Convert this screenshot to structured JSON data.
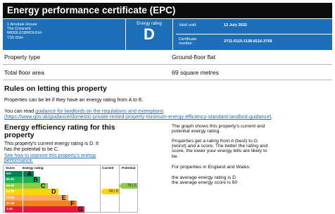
{
  "title": "Energy performance certificate (EPC)",
  "address": [
    "1 Airedale House",
    "The Crescent",
    "MIDDLESBROUGH",
    "TS5 6SH"
  ],
  "rating_label": "Energy rating",
  "rating_letter": "D",
  "valid_until_label": "Valid until:",
  "valid_until_value": "12 July 2032",
  "certificate_number_label": [
    "Certificate",
    "number:"
  ],
  "certificate_number_value": "2711-5115-1138-8116-3759",
  "summary": [
    {
      "key": "Property type",
      "value": "Ground-floor flat"
    },
    {
      "key": "Total floor area",
      "value": "69 square metres"
    }
  ],
  "rules_heading": "Rules on letting this property",
  "rules_p1": "Properties can be let if they have an energy rating from A to E.",
  "rules_p2_prefix": "You can read ",
  "rules_p2_link": "guidance for landlords on the regulations and exemptions",
  "rules_p2_url": "(https://www.gov.uk/guidance/domestic-private-rented-property-minimum-energy-efficiency-standard-landlord-guidance)",
  "rules_p2_suffix": ".",
  "efficiency_heading": [
    "Energy efficiency rating for this",
    "property"
  ],
  "efficiency_p1": [
    "This property's current energy rating is D. It",
    "has the potential to be C."
  ],
  "efficiency_link": [
    "See how to improve this property's energy",
    "performance."
  ],
  "scale_headers": {
    "score": "Score",
    "energy_rating": "Energy rating",
    "current": "Current",
    "potential": "Potential"
  },
  "bands": [
    {
      "score": "92+",
      "letter": "A",
      "color": "#008054",
      "fill": 0.14
    },
    {
      "score": "81-91",
      "letter": "B",
      "color": "#19b459",
      "fill": 0.22
    },
    {
      "score": "69-80",
      "letter": "C",
      "color": "#8dce46",
      "fill": 0.32
    },
    {
      "score": "55-68",
      "letter": "D",
      "color": "#ffd500",
      "fill": 0.46
    },
    {
      "score": "39-54",
      "letter": "E",
      "color": "#fcaa65",
      "fill": 0.59
    },
    {
      "score": "21-38",
      "letter": "F",
      "color": "#ef8023",
      "fill": 0.7
    },
    {
      "score": "1-20",
      "letter": "G",
      "color": "#e9153b",
      "fill": 0.81
    }
  ],
  "current_tag": {
    "label": "59 | D",
    "color": "#ffd500"
  },
  "potential_tag": {
    "label": "75 | C",
    "color": "#8dce46"
  },
  "right_p1": [
    "The graph shows this property's current and",
    "potential energy rating."
  ],
  "right_p2": [
    "Properties get a rating from A (best) to G",
    "(worst) and a score. The better the rating and",
    "score, the lower your energy bills are likely to",
    "be."
  ],
  "right_p3": "For properties in England and Wales:",
  "right_p4": [
    "the average energy rating is D",
    "the average energy score is 60"
  ]
}
